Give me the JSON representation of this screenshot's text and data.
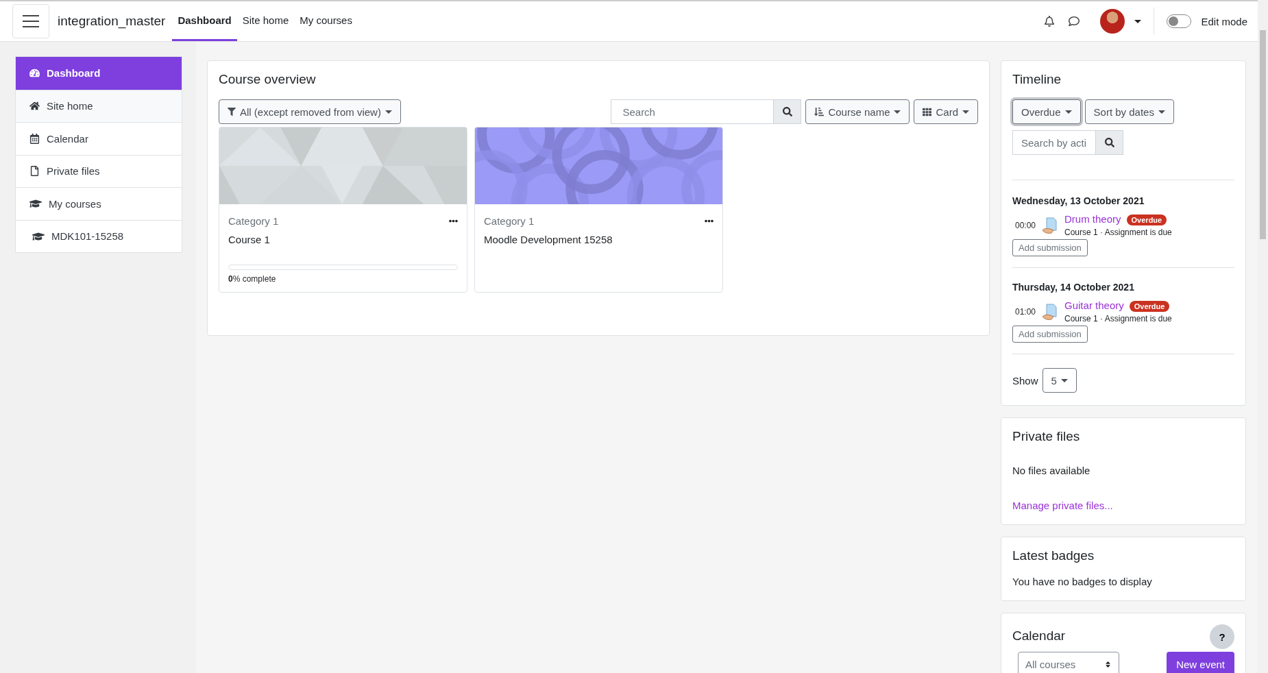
{
  "header": {
    "site_name": "integration_master",
    "nav": [
      {
        "label": "Dashboard",
        "selected": true
      },
      {
        "label": "Site home",
        "selected": false
      },
      {
        "label": "My courses",
        "selected": false
      }
    ],
    "edit_mode": {
      "label": "Edit mode",
      "on": false
    }
  },
  "sidebar": {
    "items": [
      {
        "label": "Dashboard",
        "selected": true
      },
      {
        "label": "Site home",
        "selected": false
      },
      {
        "label": "Calendar",
        "selected": false
      },
      {
        "label": "Private files",
        "selected": false
      },
      {
        "label": "My courses",
        "selected": false
      },
      {
        "label": "MDK101-15258",
        "selected": false
      }
    ]
  },
  "course_overview": {
    "title": "Course overview",
    "filter": "All (except removed from view)",
    "search": {
      "placeholder": "Search"
    },
    "sort": "Course name",
    "view": "Card",
    "courses": [
      {
        "category": "Category 1",
        "name": "Course 1",
        "progress": {
          "level": 0,
          "label": "**0**% complete"
        }
      },
      {
        "category": "Category 1",
        "name": "Moodle Development 15258"
      }
    ]
  },
  "timeline": {
    "title": "Timeline",
    "filter": "Overdue",
    "sort": "Sort by dates",
    "search": {
      "placeholder": "Search by acti"
    },
    "groups": [
      {
        "date": "Wednesday, 13 October 2021",
        "events": [
          {
            "time": "00:00",
            "name": "Drum theory",
            "badge": "Overdue",
            "detail": "Course 1 · Assignment is due",
            "action": "Add submission"
          }
        ]
      },
      {
        "date": "Thursday, 14 October 2021",
        "events": [
          {
            "time": "01:00",
            "name": "Guitar theory",
            "badge": "Overdue",
            "detail": "Course 1 · Assignment is due",
            "action": "Add submission"
          }
        ]
      }
    ],
    "show_label": "Show",
    "show_value": "5"
  },
  "private_files": {
    "title": "Private files",
    "message": "No files available",
    "link": "Manage private files..."
  },
  "latest_badges": {
    "title": "Latest badges",
    "message": "You have no badges to display"
  },
  "calendar": {
    "title": "Calendar",
    "help": "?",
    "course_select": "All courses",
    "new_event": "New event"
  }
}
